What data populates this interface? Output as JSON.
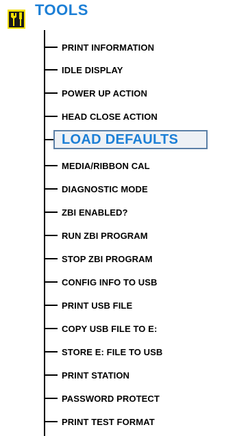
{
  "menu": {
    "title": "TOOLS",
    "icon": "tools-icon",
    "accent_color": "#1c7fd6",
    "items": [
      {
        "label": "PRINT INFORMATION"
      },
      {
        "label": "IDLE DISPLAY"
      },
      {
        "label": "POWER UP ACTION"
      },
      {
        "label": "HEAD CLOSE ACTION"
      },
      {
        "label": "LOAD DEFAULTS"
      },
      {
        "label": "MEDIA/RIBBON CAL"
      },
      {
        "label": "DIAGNOSTIC MODE"
      },
      {
        "label": "ZBI ENABLED?"
      },
      {
        "label": "RUN ZBI PROGRAM"
      },
      {
        "label": "STOP ZBI PROGRAM"
      },
      {
        "label": "CONFIG INFO TO USB"
      },
      {
        "label": "PRINT USB FILE"
      },
      {
        "label": "COPY USB FILE TO E:"
      },
      {
        "label": "STORE E: FILE TO USB"
      },
      {
        "label": "PRINT STATION"
      },
      {
        "label": "PASSWORD PROTECT"
      },
      {
        "label": "PRINT TEST FORMAT"
      }
    ]
  }
}
